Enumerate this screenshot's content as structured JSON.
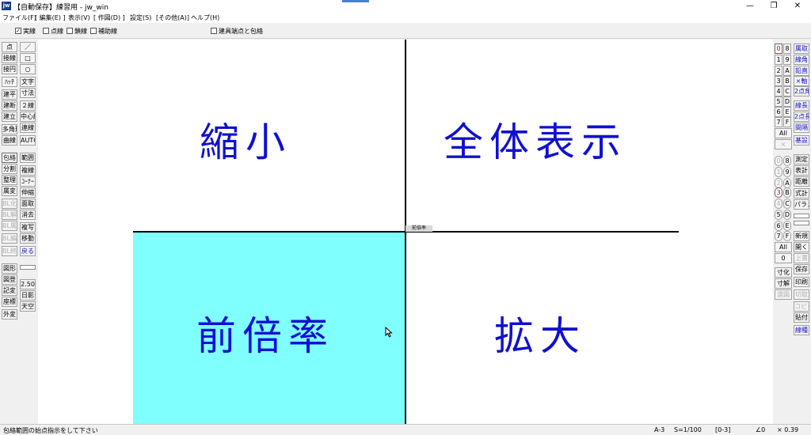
{
  "window": {
    "title": "【自動保存】練習用 - jw_win",
    "logo": "jw",
    "controls": {
      "minimize": "—",
      "restore": "❐",
      "close": "✕"
    }
  },
  "menu": [
    "ファイル(F)",
    "[ 編集(E) ]",
    "表示(V)",
    "[ 作図(D) ]",
    "設定(S)",
    "[その他(A)]",
    "ヘルプ(H)"
  ],
  "toolbar": {
    "line_types": [
      {
        "label": "実線",
        "checked": true
      },
      {
        "label": "点線",
        "checked": false
      },
      {
        "label": "鎖線",
        "checked": false
      },
      {
        "label": "補助線",
        "checked": false
      }
    ],
    "fixture_option": {
      "label": "建具端点と包絡",
      "checked": false
    }
  },
  "left_tools": {
    "col1": [
      "点",
      "接線",
      "接円",
      "ﾊｯﾁ",
      "建平",
      "建断",
      "建立",
      "多角形",
      "曲線",
      "包絡",
      "分割",
      "整理",
      "属変",
      "BL化",
      "BL解",
      "BL属",
      "BL編",
      "BL終",
      "図形",
      "図登",
      "記変",
      "座標",
      "外変"
    ],
    "col2": [
      "／",
      "□",
      "○",
      "文字",
      "寸法",
      "２線",
      "中心線",
      "連線",
      "AUTO",
      "範囲",
      "複線",
      "ｺｰﾅｰ",
      "伸縮",
      "面取",
      "消去",
      "複写",
      "移動",
      "戻る",
      "",
      "2.50",
      "日影",
      "天空"
    ]
  },
  "right_tools": {
    "layer_col1": [
      "0",
      "1",
      "2",
      "3",
      "4",
      "5",
      "6",
      "7",
      "All",
      "×"
    ],
    "layer_col2": [
      "8",
      "9",
      "A",
      "B",
      "C",
      "D",
      "E",
      "F"
    ],
    "group_col1": [
      "0",
      "1",
      "2",
      "3",
      "4",
      "5",
      "6",
      "7",
      "All",
      "0"
    ],
    "group_col2": [
      "8",
      "9",
      "A",
      "B",
      "C",
      "D",
      "E",
      "F"
    ],
    "cmd1": [
      "属取",
      "線角",
      "鉛直",
      "×軸",
      "2点角",
      "線長",
      "2点長",
      "間隔",
      "基設"
    ],
    "cmd2": [
      "測定",
      "表計",
      "距離",
      "式計",
      "パラメ"
    ],
    "cmd3": [
      "新規",
      "開く",
      "上書",
      "保存",
      "印刷",
      "切取",
      "コピー",
      "貼付",
      "線種"
    ],
    "cmd4": [
      "寸化",
      "寸解",
      "選図"
    ]
  },
  "canvas": {
    "top_left": "縮小",
    "top_right": "全体表示",
    "bottom_left": "前倍率",
    "bottom_right": "拡大",
    "center_label": "前倍率",
    "highlight_color": "#80ffff",
    "label_color": "#1010d0"
  },
  "status": {
    "message": "包絡範囲の始点指示をして下さい",
    "paper": "A-3",
    "scale": "S=1/100",
    "layer": "[0-3]",
    "angle": "∠0",
    "zoom": "× 0.39"
  }
}
